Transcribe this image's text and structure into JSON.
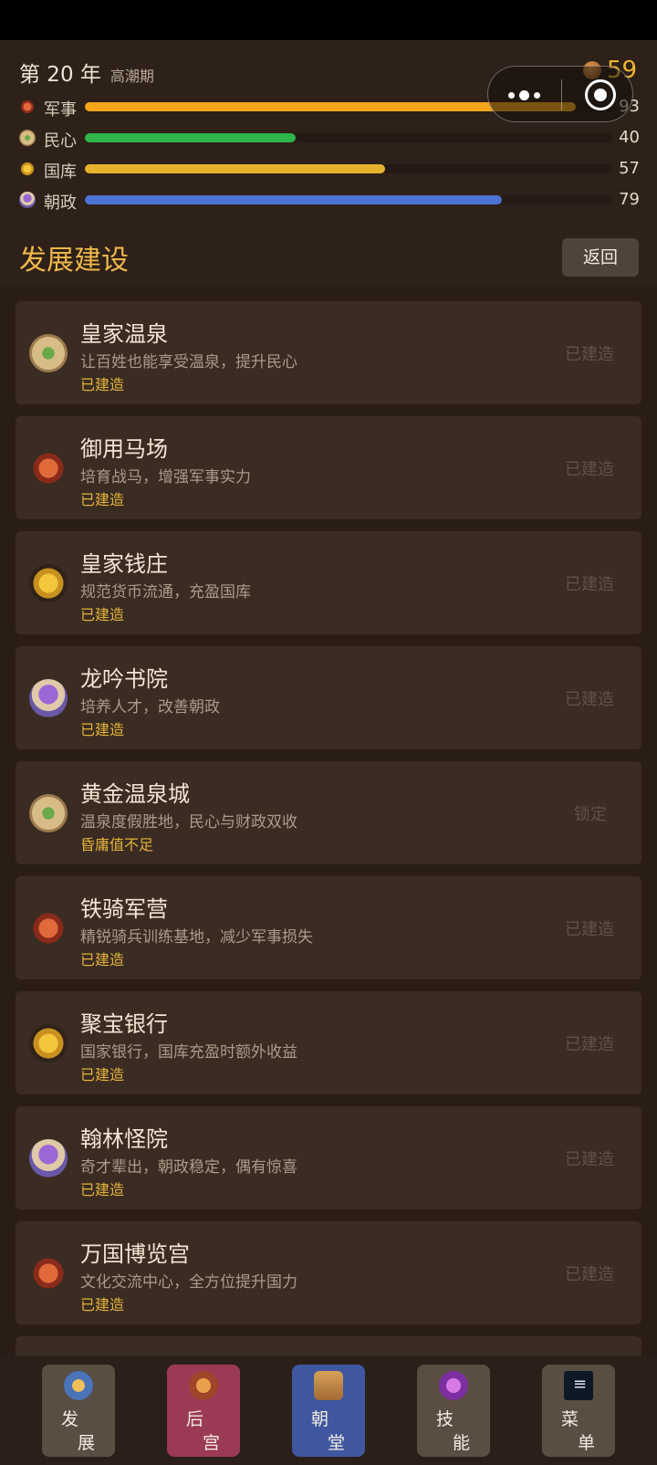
{
  "header": {
    "year_label": "第 20 年",
    "phase": "高潮期",
    "gold": "59",
    "stats": [
      {
        "label": "军事",
        "value": "93",
        "percent": 93,
        "color": "#f2a51a",
        "icon": "military-icon"
      },
      {
        "label": "民心",
        "value": "40",
        "percent": 40,
        "color": "#2fb44a",
        "icon": "people-icon"
      },
      {
        "label": "国库",
        "value": "57",
        "percent": 57,
        "color": "#e6b22e",
        "icon": "treasury-icon"
      },
      {
        "label": "朝政",
        "value": "79",
        "percent": 79,
        "color": "#4d72d6",
        "icon": "court-icon"
      }
    ]
  },
  "section": {
    "title": "发展建设",
    "back_label": "返回"
  },
  "buildings": [
    {
      "name": "皇家温泉",
      "desc": "让百姓也能享受温泉，提升民心",
      "status": "已建造",
      "action": "已建造",
      "icon": "people"
    },
    {
      "name": "御用马场",
      "desc": "培育战马，增强军事实力",
      "status": "已建造",
      "action": "已建造",
      "icon": "army"
    },
    {
      "name": "皇家钱庄",
      "desc": "规范货币流通，充盈国库",
      "status": "已建造",
      "action": "已建造",
      "icon": "treasury"
    },
    {
      "name": "龙吟书院",
      "desc": "培养人才，改善朝政",
      "status": "已建造",
      "action": "已建造",
      "icon": "court"
    },
    {
      "name": "黄金温泉城",
      "desc": "温泉度假胜地，民心与财政双收",
      "status": "昏庸值不足",
      "action": "锁定",
      "icon": "people"
    },
    {
      "name": "铁骑军营",
      "desc": "精锐骑兵训练基地，减少军事损失",
      "status": "已建造",
      "action": "已建造",
      "icon": "army"
    },
    {
      "name": "聚宝银行",
      "desc": "国家银行，国库充盈时额外收益",
      "status": "已建造",
      "action": "已建造",
      "icon": "treasury"
    },
    {
      "name": "翰林怪院",
      "desc": "奇才辈出，朝政稳定，偶有惊喜",
      "status": "已建造",
      "action": "已建造",
      "icon": "court"
    },
    {
      "name": "万国博览宫",
      "desc": "文化交流中心，全方位提升国力",
      "status": "已建造",
      "action": "已建造",
      "icon": "army"
    }
  ],
  "bottom_nav": [
    {
      "line1": "发",
      "line2": "展"
    },
    {
      "line1": "后",
      "line2": "宫"
    },
    {
      "line1": "朝",
      "line2": "堂"
    },
    {
      "line1": "技",
      "line2": "能"
    },
    {
      "line1": "菜",
      "line2": "单"
    }
  ]
}
